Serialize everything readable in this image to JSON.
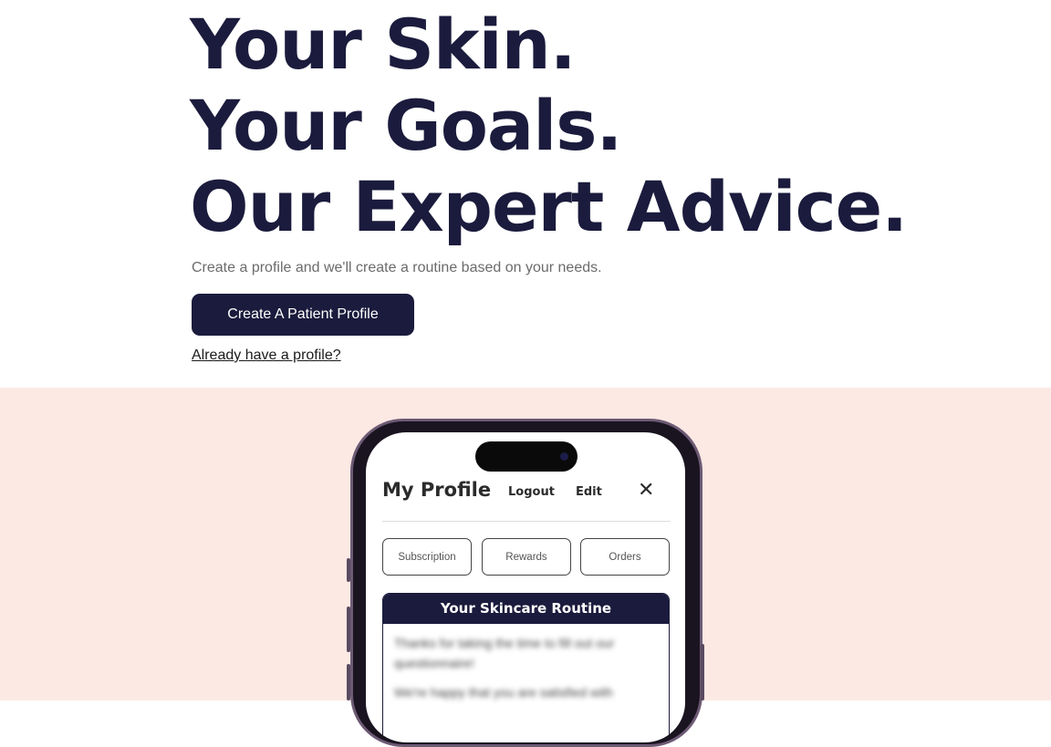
{
  "hero": {
    "headline": [
      "Your Skin.",
      "Your Goals.",
      "Our Expert Advice."
    ],
    "subtitle": "Create a profile and we'll create a routine based on your needs.",
    "cta_label": "Create A Patient Profile",
    "profile_link": "Already have a profile?"
  },
  "phone": {
    "title": "My Profile",
    "logout_label": "Logout",
    "edit_label": "Edit",
    "close_icon": "close-icon",
    "tabs": [
      "Subscription",
      "Rewards",
      "Orders"
    ],
    "routine": {
      "heading": "Your Skincare Routine",
      "paragraphs": [
        "Thanks for taking the time to fill out our questionnaire!",
        "We're happy that you are satisfied with"
      ]
    }
  },
  "colors": {
    "navy": "#1b1b3d",
    "peach_bg": "#fce9e4",
    "text_muted": "#6b6b6b"
  }
}
